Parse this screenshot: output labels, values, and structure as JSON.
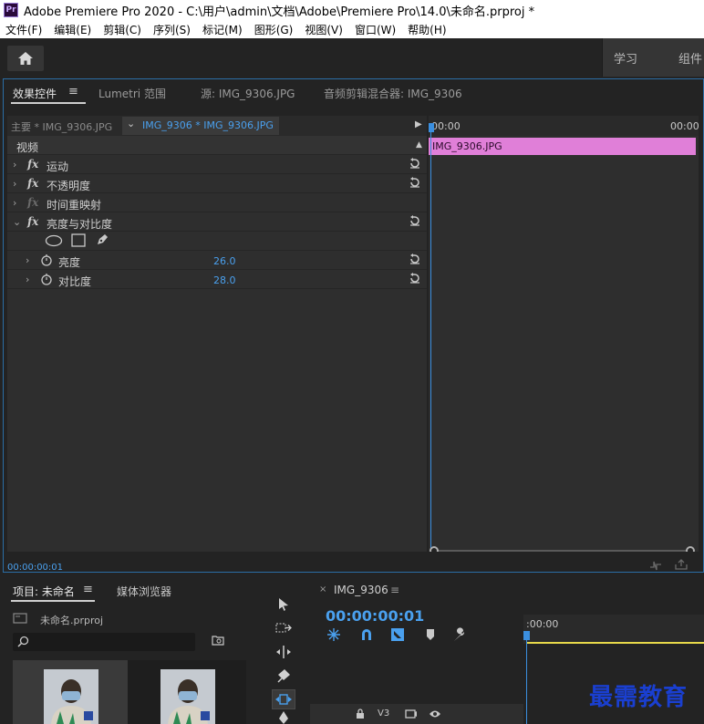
{
  "window": {
    "app_icon": "Pr",
    "title": "Adobe Premiere Pro 2020 - C:\\用户\\admin\\文档\\Adobe\\Premiere Pro\\14.0\\未命名.prproj *"
  },
  "menu": [
    "文件(F)",
    "编辑(E)",
    "剪辑(C)",
    "序列(S)",
    "标记(M)",
    "图形(G)",
    "视图(V)",
    "窗口(W)",
    "帮助(H)"
  ],
  "workspace": {
    "home_icon": "home-icon",
    "tabs": [
      "学习",
      "组件"
    ]
  },
  "effect_panel": {
    "tabs": [
      "效果控件",
      "Lumetri 范围",
      "源: IMG_9306.JPG",
      "音频剪辑混合器: IMG_9306"
    ],
    "tab_menu_icon": "≡",
    "master_clip": "主要 * IMG_9306.JPG",
    "sequence_clip": "IMG_9306 * IMG_9306.JPG",
    "section_video": "视频",
    "effects": [
      {
        "label": "运动"
      },
      {
        "label": "不透明度"
      },
      {
        "label": "时间重映射"
      },
      {
        "label": "亮度与对比度"
      }
    ],
    "params": [
      {
        "label": "亮度",
        "value": "26.0"
      },
      {
        "label": "对比度",
        "value": "28.0"
      }
    ],
    "timeline_start": "00:00",
    "timeline_end": "00:00",
    "clip_label": "IMG_9306.JPG",
    "current_time": "00:00:00:01"
  },
  "project_panel": {
    "tabs": [
      "项目: 未命名",
      "媒体浏览器"
    ],
    "tab_menu_icon": "≡",
    "file": "未命名.prproj"
  },
  "timeline_panel": {
    "close": "×",
    "tab": "IMG_9306",
    "tab_menu_icon": "≡",
    "timecode": "00:00:00:01",
    "ruler_time": ":00:00",
    "track": "V3"
  },
  "watermark": "最需教育",
  "colors": {
    "accent": "#4aa0ee",
    "clip": "#e07fd8",
    "work_area": "#e8d94a",
    "playhead": "#3b8fdf"
  }
}
